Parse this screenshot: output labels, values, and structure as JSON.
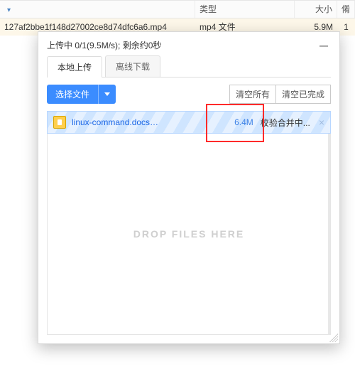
{
  "table": {
    "headers": {
      "name": "",
      "type": "类型",
      "size": "大小",
      "attr": "倄"
    },
    "sort_indicator": "▾",
    "row": {
      "name": "127af2bbe1f148d27002ce8d74dfc6a6.mp4",
      "type": "mp4 文件",
      "size": "5.9M",
      "attr": "1"
    }
  },
  "dialog": {
    "title": "上传中 0/1(9.5M/s); 剩余约0秒",
    "minimize": "—",
    "tabs": {
      "local": "本地上传",
      "remote": "离线下载"
    },
    "select_file": "选择文件",
    "clear_all": "清空所有",
    "clear_done": "清空已完成",
    "drop_text": "DROP FILES HERE"
  },
  "upload_item": {
    "name": "linux-command.docs…",
    "size": "6.4M",
    "status": "校验合并中...",
    "close": "×"
  },
  "colors": {
    "accent": "#3b8cff",
    "link": "#1a66e6",
    "highlight_border": "#ff2a2a"
  }
}
